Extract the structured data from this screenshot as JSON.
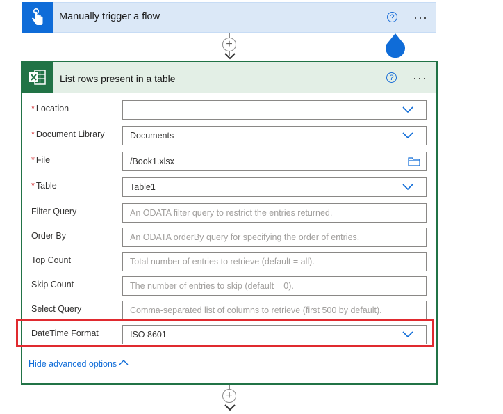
{
  "trigger": {
    "title": "Manually trigger a flow",
    "help_label": "?",
    "more_label": "···"
  },
  "connector": {
    "add_label": "+"
  },
  "action": {
    "title": "List rows present in a table",
    "help_label": "?",
    "more_label": "···",
    "fields": [
      {
        "label": "Location",
        "required": "*",
        "value": "",
        "placeholder": ""
      },
      {
        "label": "Document Library",
        "required": "*",
        "value": "Documents"
      },
      {
        "label": "File",
        "required": "*",
        "value": "/Book1.xlsx"
      },
      {
        "label": "Table",
        "required": "*",
        "value": "Table1"
      },
      {
        "label": "Filter Query",
        "placeholder": "An ODATA filter query to restrict the entries returned."
      },
      {
        "label": "Order By",
        "placeholder": "An ODATA orderBy query for specifying the order of entries."
      },
      {
        "label": "Top Count",
        "placeholder": "Total number of entries to retrieve (default = all)."
      },
      {
        "label": "Skip Count",
        "placeholder": "The number of entries to skip (default = 0)."
      },
      {
        "label": "Select Query",
        "placeholder": "Comma-separated list of columns to retrieve (first 500 by default)."
      },
      {
        "label": "DateTime Format",
        "value": "ISO 8601"
      }
    ],
    "hide_advanced_label": "Hide advanced options"
  },
  "colors": {
    "accent_blue": "#0f6cd8",
    "excel_green": "#217346",
    "highlight_red": "#e02a2f",
    "trigger_bg": "#dbe8f7",
    "action_header_bg": "#e3efe6"
  },
  "icons": {
    "trigger": "hand-touch-icon",
    "action": "excel-icon",
    "dropdown": "chevron-down-icon",
    "file_picker": "folder-icon"
  }
}
